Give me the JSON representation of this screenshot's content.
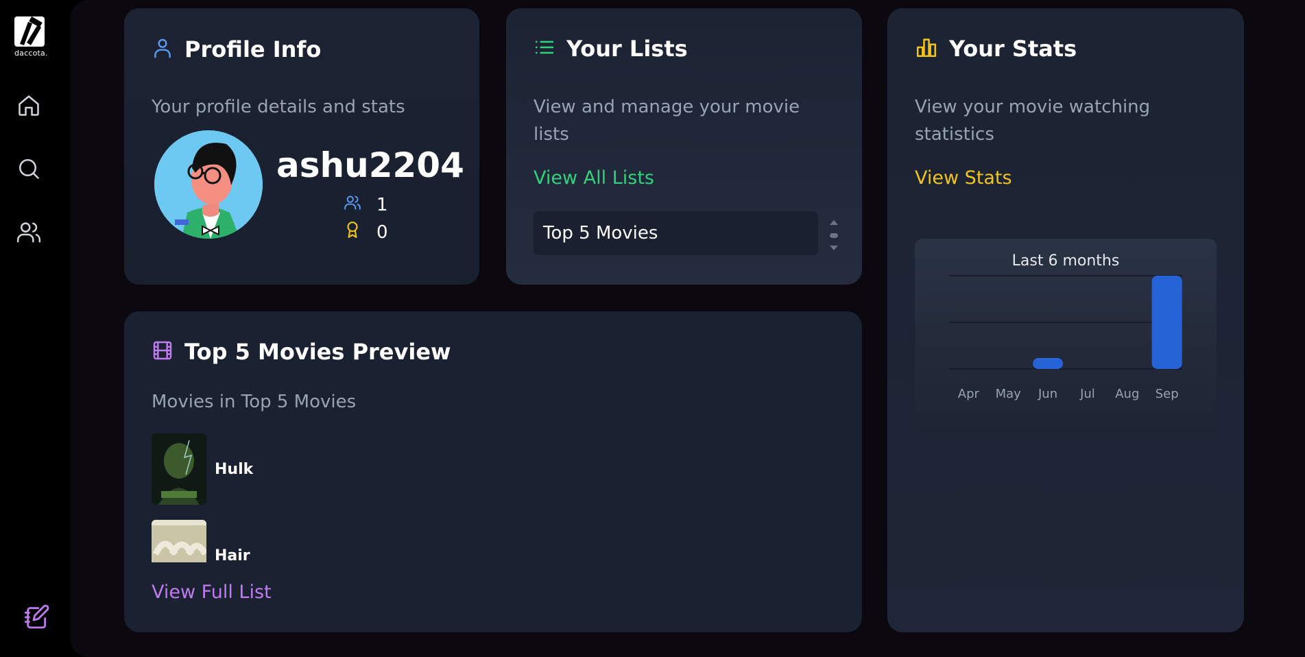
{
  "sidebar": {
    "logo_text": "daccota.",
    "nav": [
      "home-icon",
      "search-icon",
      "users-icon"
    ],
    "bottom_icon": "edit-notebook-icon"
  },
  "profile": {
    "title": "Profile Info",
    "subtitle": "Your profile details and stats",
    "username": "ashu2204",
    "followers": "1",
    "awards": "0"
  },
  "lists": {
    "title": "Your Lists",
    "subtitle": "View and manage your movie lists",
    "link": "View All Lists",
    "selected_list": "Top 5 Movies"
  },
  "stats": {
    "title": "Your Stats",
    "subtitle": "View your movie watching statistics",
    "link": "View Stats"
  },
  "preview": {
    "title": "Top 5 Movies Preview",
    "subtitle": "Movies in Top 5 Movies",
    "movies": [
      {
        "name": "Hulk"
      },
      {
        "name": "Hair"
      }
    ],
    "link": "View Full List"
  },
  "colors": {
    "accent_green": "#34d17c",
    "accent_yellow": "#f0c419",
    "accent_purple": "#c17bf0",
    "accent_blue": "#5b9bf5",
    "bar_blue": "#2563d6"
  },
  "chart_data": {
    "type": "bar",
    "title": "Last 6 months",
    "categories": [
      "Apr",
      "May",
      "Jun",
      "Jul",
      "Aug",
      "Sep"
    ],
    "values": [
      0,
      0,
      0.2,
      0,
      0,
      2
    ],
    "ylim": [
      0,
      2
    ],
    "grid": true,
    "xlabel": "",
    "ylabel": ""
  }
}
